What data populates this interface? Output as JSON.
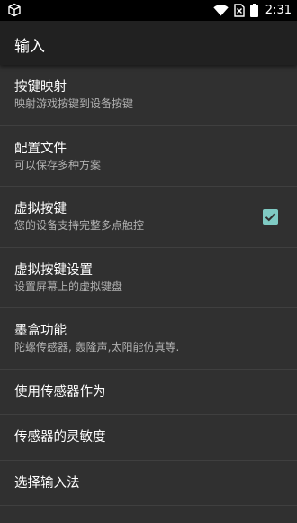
{
  "status_bar": {
    "time": "2:31",
    "left_icon": "cube-icon",
    "icons": [
      "wifi-icon",
      "sim-icon",
      "battery-icon"
    ]
  },
  "app_bar": {
    "title": "输入"
  },
  "settings": [
    {
      "title": "按键映射",
      "summary": "映射游戏按键到设备按键"
    },
    {
      "title": "配置文件",
      "summary": "可以保存多种方案"
    },
    {
      "title": "虚拟按键",
      "summary": "您的设备支持完整多点触控",
      "checked": true
    },
    {
      "title": "虚拟按键设置",
      "summary": "设置屏幕上的虚拟键盘"
    },
    {
      "title": "墨盒功能",
      "summary": "陀螺传感器, 轰隆声,太阳能仿真等."
    },
    {
      "title": "使用传感器作为"
    },
    {
      "title": "传感器的灵敏度"
    },
    {
      "title": "选择输入法"
    }
  ],
  "colors": {
    "accent": "#7fcbc4",
    "background": "#303030",
    "app_bar": "#212121"
  }
}
